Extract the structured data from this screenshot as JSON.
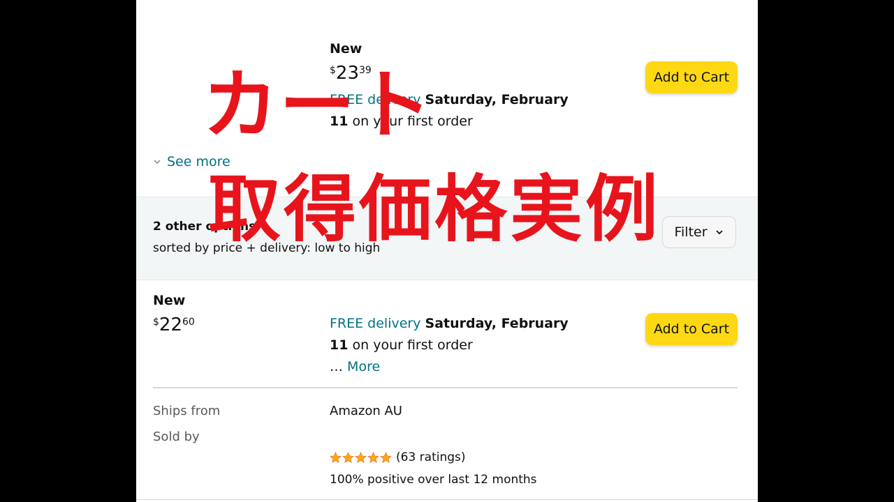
{
  "offer_top": {
    "condition": "New",
    "price_symbol": "$",
    "price_whole": "23",
    "price_fraction": "39",
    "delivery_prefix": "FREE delivery",
    "delivery_date_line1": "Saturday, February",
    "delivery_date_line2": "11",
    "delivery_suffix": "on your first order",
    "add_to_cart": "Add to Cart",
    "see_more": "See more"
  },
  "other_options": {
    "title": "2 other options",
    "sort_text": "sorted by price + delivery: low to high",
    "filter_label": "Filter"
  },
  "offer_second": {
    "condition": "New",
    "price_symbol": "$",
    "price_whole": "22",
    "price_fraction": "60",
    "delivery_prefix": "FREE delivery",
    "delivery_date_line1": "Saturday, February",
    "delivery_date_line2": "11",
    "delivery_suffix": "on your first order",
    "more_ellipsis": "…",
    "more_link": "More",
    "add_to_cart": "Add to Cart",
    "ships_from_label": "Ships from",
    "ships_from_value": "Amazon AU",
    "sold_by_label": "Sold by",
    "rating_stars": 5,
    "ratings_count": "(63 ratings)",
    "positive_text": "100% positive over last 12 months"
  },
  "overlay_text": {
    "line1": "カート",
    "line2": "取得価格実例"
  },
  "colors": {
    "teal_link": "#007185",
    "cart_button": "#ffd814",
    "overlay_red": "#e8141c",
    "star": "#ffa41c"
  }
}
